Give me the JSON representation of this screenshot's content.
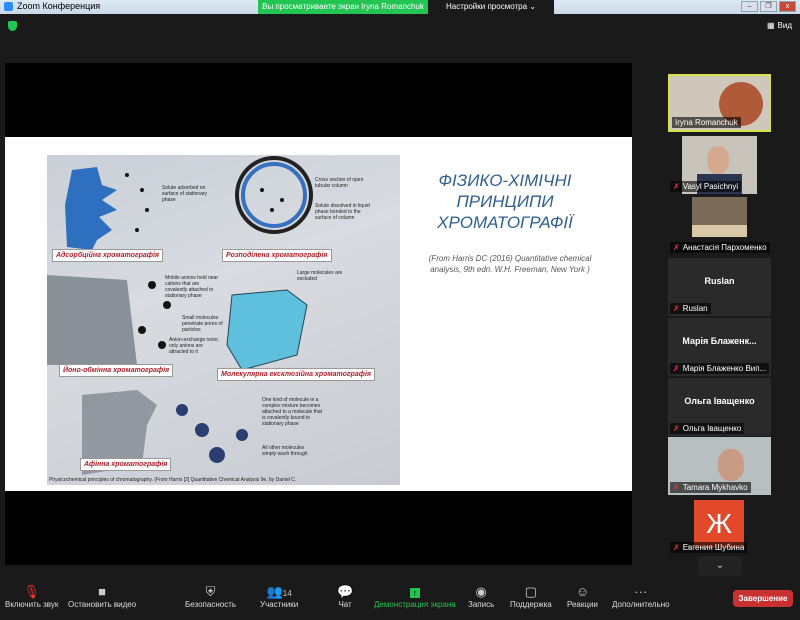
{
  "window": {
    "title": "Zoom Конференция",
    "banner": "Вы просматриваете экран Iryna Romanchuk",
    "view_settings": "Настройки просмотра ⌄",
    "min": "–",
    "max": "❐",
    "close": "x"
  },
  "header": {
    "view_label": "Вид"
  },
  "slide": {
    "title": "ФІЗИКО-ХІМІЧНІ ПРИНЦИПИ ХРОМАТОГРАФІЇ",
    "reference": "(From Harris DC (2016) Quantitative chemical analysis, 9th edn. W.H. Freeman, New York )",
    "labels": [
      "Адсорбційна хроматографія",
      "Розподілена хроматографія",
      "Йоно-обмінна хроматографія",
      "Молекулярна ексклюзійна хроматографія",
      "Афінна хроматографія"
    ],
    "captions": [
      "Solute adsorbed on surface of stationary phase",
      "Cross section of open tubular column",
      "Solute dissolved in liquid phase bonded to the surface of column",
      "Mobile anions held near cations that are covalently attached to stationary phase",
      "Large molecules are excluded",
      "Small molecules penetrate pores of particles",
      "Anion-exchange resin; only anions are attracted to it",
      "One kind of molecule in a complex mixture becomes attached to a molecule that is covalently bound to stationary phase",
      "All other molecules simply wash through",
      "Physicochemical principles of chromatography. (From Harris [2] Quantitative Chemical Analysis 9e, by Daniel C."
    ]
  },
  "participants": [
    {
      "name": "Iryna Romanchuk",
      "video": true,
      "active": true
    },
    {
      "name": "Vasyl Pasichnyi",
      "video": true
    },
    {
      "name": "Анастасія Пархоменко",
      "video": true
    },
    {
      "name": "Ruslan",
      "big": "Ruslan"
    },
    {
      "name": "Марія Блаженко Вип...",
      "big": "Марія  Блаженк..."
    },
    {
      "name": "Ольга Іващенко",
      "big": "Ольга Іващенко"
    },
    {
      "name": "Tamara Mykhavko",
      "video": true
    },
    {
      "name": "Евгения Шубина",
      "avatar": "Ж"
    }
  ],
  "toolbar": {
    "mute": "Включить звук",
    "video": "Остановить видео",
    "security": "Безопасность",
    "participants": "Участники",
    "participants_count": "14",
    "chat": "Чат",
    "share": "Демонстрация экрана",
    "record": "Запись",
    "support": "Поддержка",
    "reactions": "Реакции",
    "more": "Дополнительно",
    "end": "Завершение"
  }
}
